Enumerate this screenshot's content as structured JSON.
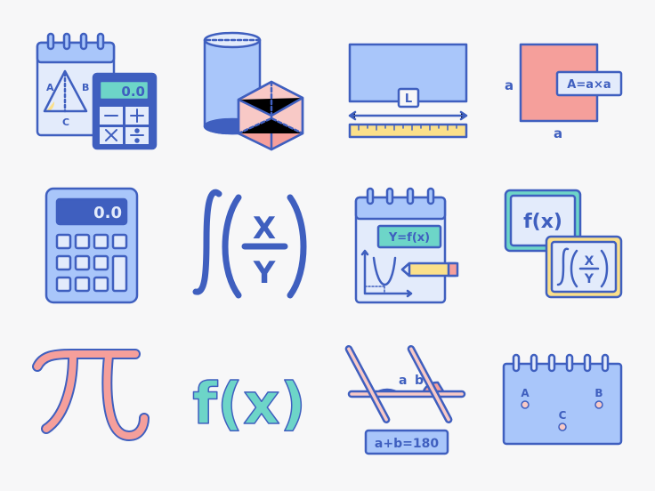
{
  "colors": {
    "stroke": "#3f5fbf",
    "blue": "#a9c6fa",
    "pale": "#e3ebfb",
    "pink": "#f59f9b",
    "lightpink": "#f8c9c6",
    "teal": "#6dd5c8",
    "yellow": "#fbe08a",
    "background": "#f7f7f8"
  },
  "icons": [
    {
      "name": "triangle-notepad-calculator",
      "labels": {
        "a": "A",
        "b": "B",
        "c": "C",
        "display": "0.0"
      }
    },
    {
      "name": "cylinder-cube"
    },
    {
      "name": "rectangle-length-ruler",
      "labels": {
        "length": "L"
      }
    },
    {
      "name": "square-area",
      "labels": {
        "side_left": "a",
        "side_bottom": "a",
        "formula": "A=a×a"
      }
    },
    {
      "name": "calculator",
      "labels": {
        "display": "0.0"
      }
    },
    {
      "name": "integral-fraction",
      "labels": {
        "numerator": "X",
        "denominator": "Y"
      }
    },
    {
      "name": "function-graph-notepad",
      "labels": {
        "formula": "Y=f(x)"
      }
    },
    {
      "name": "function-integral-cards",
      "labels": {
        "card1": "f(x)",
        "num": "X",
        "den": "Y"
      }
    },
    {
      "name": "pi-symbol",
      "labels": {
        "symbol": "π"
      }
    },
    {
      "name": "function-symbol",
      "labels": {
        "symbol": "f(x)"
      }
    },
    {
      "name": "parallel-lines-angles",
      "labels": {
        "a": "a",
        "b": "b",
        "formula": "a+b=180"
      }
    },
    {
      "name": "points-notepad",
      "labels": {
        "a": "A",
        "b": "B",
        "c": "C"
      }
    }
  ]
}
